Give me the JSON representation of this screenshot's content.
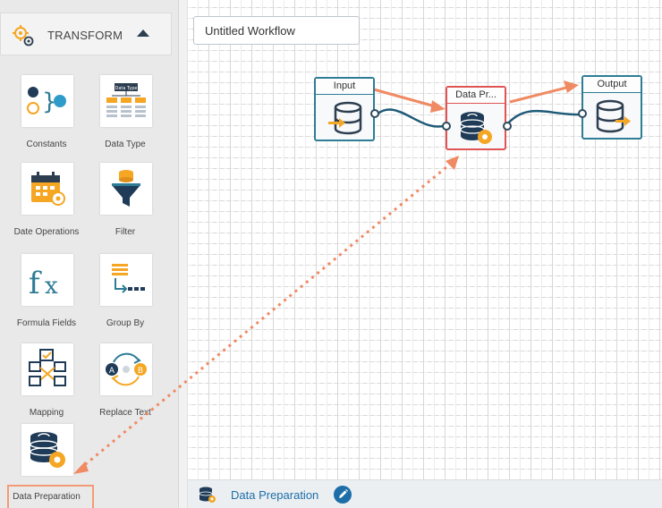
{
  "sidebar": {
    "header": {
      "title": "TRANSFORM",
      "icon": "gears-icon",
      "toggle": "collapse-caret-icon"
    },
    "tools": [
      {
        "label": "Constants",
        "icon": "constants-icon"
      },
      {
        "label": "Data Type",
        "icon": "data-type-icon"
      },
      {
        "label": "Date Operations",
        "icon": "calendar-gear-icon"
      },
      {
        "label": "Filter",
        "icon": "funnel-icon"
      },
      {
        "label": "Formula Fields",
        "icon": "fx-icon"
      },
      {
        "label": "Group By",
        "icon": "group-by-icon"
      },
      {
        "label": "Mapping",
        "icon": "mapping-icon"
      },
      {
        "label": "Replace Text",
        "icon": "replace-text-icon"
      },
      {
        "label": "Data Preparation",
        "icon": "database-gear-icon"
      }
    ],
    "data_type_mini_label": "Data Type"
  },
  "canvas": {
    "workflow_name": "Untitled Workflow",
    "nodes": [
      {
        "title": "Input",
        "icon": "database-input-icon"
      },
      {
        "title": "Data Pr...",
        "icon": "database-gear-icon",
        "selected": true
      },
      {
        "title": "Output",
        "icon": "database-output-icon"
      }
    ]
  },
  "bottom_bar": {
    "label": "Data Preparation",
    "icon": "database-gear-icon",
    "edit_icon": "pencil-icon"
  },
  "colors": {
    "accent_blue": "#1d6ea8",
    "node_border": "#2e7c96",
    "selected_border": "#e05454",
    "arrow_orange": "#f08a63",
    "gear_orange": "#f5a623"
  }
}
